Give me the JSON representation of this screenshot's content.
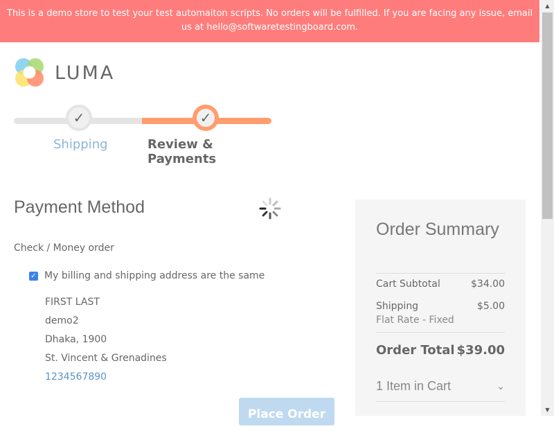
{
  "banner": {
    "text": "This is a demo store to test your test automaiton scripts. No orders will be fulfilled. If you are facing any issue, email us at hello@softwaretestingboard.com."
  },
  "logo": {
    "text": "LUMA",
    "icon": "luma-logo-icon"
  },
  "progress": {
    "steps": [
      {
        "label": "Shipping",
        "state": "complete",
        "icon": "check-icon"
      },
      {
        "label": "Review & Payments",
        "state": "active",
        "icon": "check-icon"
      }
    ],
    "colors": {
      "active": "#ff9d6f",
      "inactive": "#e4e4e4"
    }
  },
  "payment": {
    "title": "Payment Method",
    "method_label": "Check / Money order",
    "same_address_checked": true,
    "same_address_label": "My billing and shipping address are the same",
    "address": {
      "name": "FIRST LAST",
      "street": "demo2",
      "city_zip": "Dhaka, 1900",
      "country": "St. Vincent & Grenadines",
      "phone": "1234567890"
    },
    "place_order_label": "Place Order"
  },
  "summary": {
    "title": "Order Summary",
    "subtotal_label": "Cart Subtotal",
    "subtotal_value": "$34.00",
    "shipping_label": "Shipping",
    "shipping_value": "$5.00",
    "shipping_method": "Flat Rate - Fixed",
    "total_label": "Order Total",
    "total_value": "$39.00",
    "items_in_cart": "1 Item in Cart"
  },
  "loading_spinner": "spinner-icon"
}
